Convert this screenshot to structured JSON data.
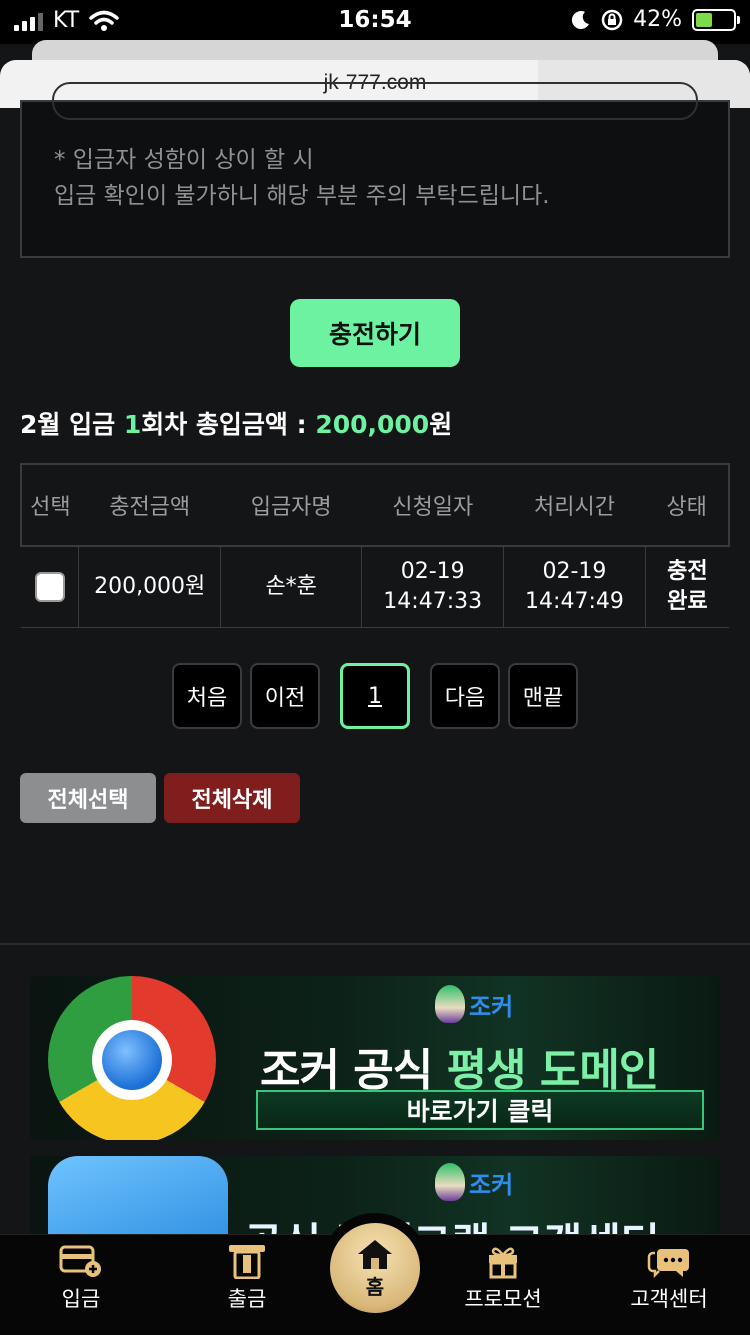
{
  "status_bar": {
    "carrier": "KT",
    "time": "16:54",
    "battery": "42%"
  },
  "browser": {
    "url": "jk-777.com"
  },
  "notice": {
    "line1": "* 입금자 성함이 상이 할 시",
    "line2": "입금 확인이 불가하니 해당 부분 주의 부탁드립니다."
  },
  "charge_button": "충전하기",
  "summary": {
    "prefix": "2월 입금 ",
    "count": "1",
    "middle": "회차 총입금액 : ",
    "amount": "200,000",
    "suffix": "원"
  },
  "table": {
    "headers": [
      "선택",
      "충전금액",
      "입금자명",
      "신청일자",
      "처리시간",
      "상태"
    ],
    "rows": [
      {
        "amount": "200,000원",
        "depositor": "손*훈",
        "req_date": "02-19",
        "req_time": "14:47:33",
        "proc_date": "02-19",
        "proc_time": "14:47:49",
        "status_l1": "충전",
        "status_l2": "완료"
      }
    ]
  },
  "pagination": {
    "first": "처음",
    "prev": "이전",
    "current": "1",
    "next": "다음",
    "last": "맨끝"
  },
  "actions": {
    "select_all": "전체선택",
    "delete_all": "전체삭제"
  },
  "banners": [
    {
      "logo": "조커",
      "title_a": "조커 공식 ",
      "title_b": "평생 도메인",
      "button": "바로가기 클릭",
      "icon": "chrome-icon"
    },
    {
      "logo": "조커",
      "title": "공식 텔레그램 고객센터",
      "icon": "telegram-icon"
    }
  ],
  "bottom_nav": {
    "deposit": "입금",
    "withdraw": "출금",
    "home": "홈",
    "promotion": "프로모션",
    "support": "고객센터"
  },
  "colors": {
    "accent": "#6df2a2",
    "danger": "#7f1e1c",
    "background": "#141517",
    "gold": "#d9b87a"
  }
}
